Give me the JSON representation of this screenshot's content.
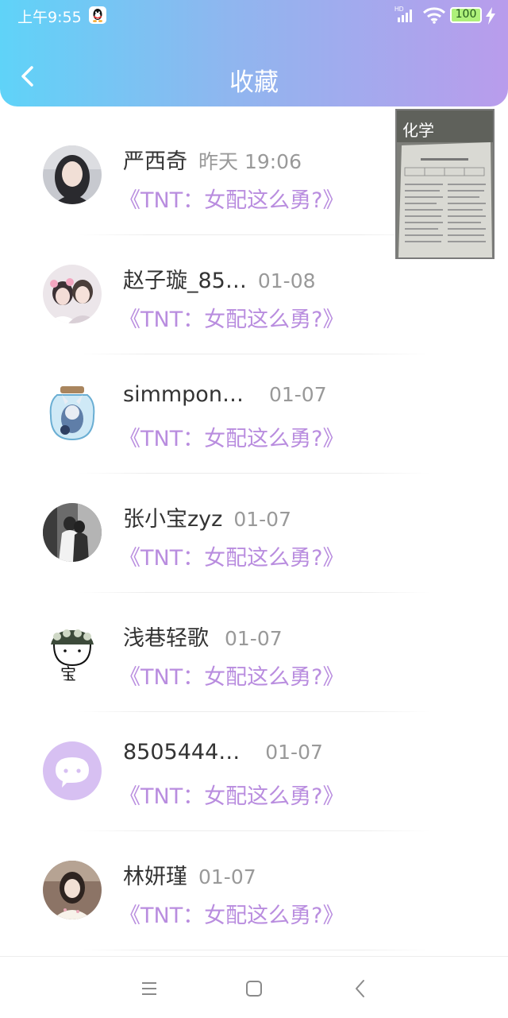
{
  "status_bar": {
    "time": "上午9:55",
    "battery": "100",
    "icons": [
      "qq-icon",
      "hd-signal-icon",
      "wifi-icon",
      "battery-icon",
      "charging-icon"
    ]
  },
  "header": {
    "title": "收藏",
    "back_icon": "chevron-left-icon",
    "colors": {
      "gradient_start": "#5fd3f8",
      "gradient_end": "#b99cec"
    }
  },
  "floating_window": {
    "label": "化学"
  },
  "favorites": [
    {
      "name": "严西奇",
      "date": "昨天 19:06",
      "title": "《TNT：女配这么勇?》"
    },
    {
      "name": "赵子璇_85…",
      "date": "01-08",
      "title": "《TNT：女配这么勇?》"
    },
    {
      "name": "simmpon…",
      "date": "01-07",
      "title": "《TNT：女配这么勇?》"
    },
    {
      "name": "张小宝zyz",
      "date": "01-07",
      "title": "《TNT：女配这么勇?》"
    },
    {
      "name": "浅巷轻歌",
      "date": "01-07",
      "title": "《TNT：女配这么勇?》"
    },
    {
      "name": "8505444…",
      "date": "01-07",
      "title": "《TNT：女配这么勇?》"
    },
    {
      "name": "林妍瑾",
      "date": "01-07",
      "title": "《TNT：女配这么勇?》"
    }
  ],
  "nav_bar": {
    "icons": [
      "menu-icon",
      "home-icon",
      "back-icon"
    ]
  },
  "accent_color": "#b98ddf"
}
